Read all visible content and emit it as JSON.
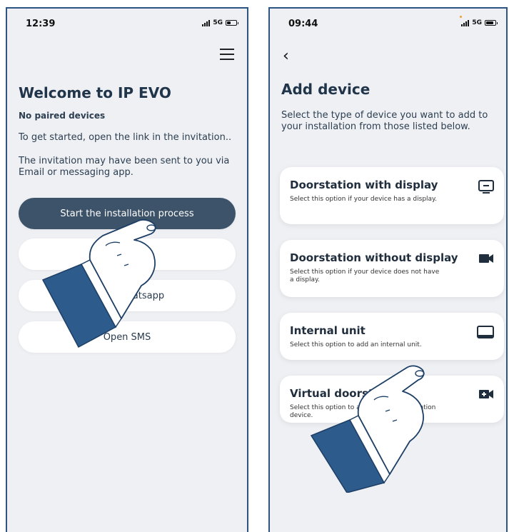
{
  "left_screen": {
    "status": {
      "time": "12:39",
      "network": "5G",
      "battery_level": 0.45
    },
    "title": "Welcome to IP EVO",
    "subtitle": "No paired devices",
    "instruction_1": "To get started, open the link in the invitation..",
    "instruction_2": "The invitation may have been sent to you via Email or messaging app.",
    "buttons": {
      "start": "Start the installation process",
      "whatsapp": "Open Whatsapp",
      "sms": "Open SMS"
    }
  },
  "right_screen": {
    "status": {
      "time": "09:44",
      "network": "5G",
      "battery_level": 0.85
    },
    "title": "Add device",
    "intro": "Select the type of device you want to add to your installation from those listed below.",
    "options": [
      {
        "title": "Doorstation with display",
        "desc": "Select this option if your device has a display.",
        "icon": "monitor-icon"
      },
      {
        "title": "Doorstation without display",
        "desc": "Select this option if your device does not have a display.",
        "icon": "video-camera-icon"
      },
      {
        "title": "Internal unit",
        "desc": "Select this option to add an internal unit.",
        "icon": "tablet-icon"
      },
      {
        "title": "Virtual doorstation",
        "desc": "Select this option to add a virtual doorstation device.",
        "icon": "video-plus-icon"
      }
    ]
  },
  "colors": {
    "frame": "#2c5583",
    "primary_button": "#3d5369",
    "sleeve": "#2d5b8c"
  }
}
